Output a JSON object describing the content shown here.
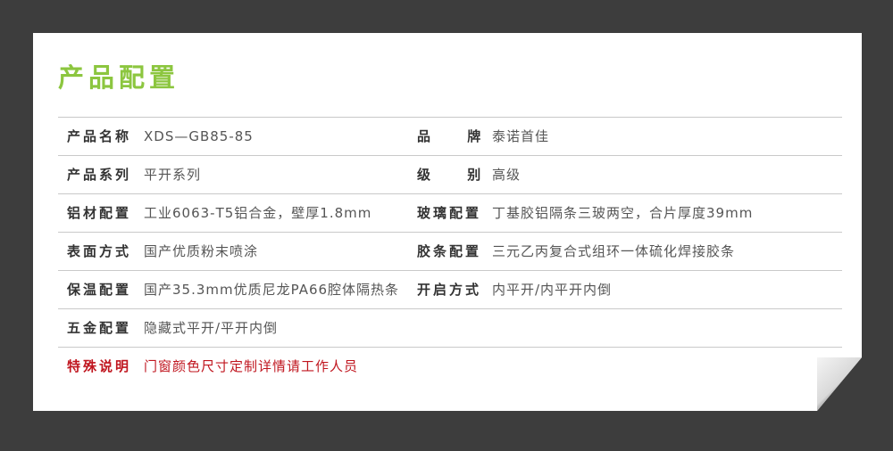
{
  "title": "产品配置",
  "colors": {
    "title": "#8cc63f",
    "special": "#c0161f",
    "label": "#333333",
    "value": "#555555",
    "background": "#3d3d3d"
  },
  "specs": [
    {
      "label1": "产品名称",
      "value1": "XDS—GB85-85",
      "label2": "品 牌",
      "value2": "泰诺首佳"
    },
    {
      "label1": "产品系列",
      "value1": "平开系列",
      "label2": "级 别",
      "value2": "高级"
    },
    {
      "label1": "铝材配置",
      "value1": "工业6063-T5铝合金，壁厚1.8mm",
      "label2": "玻璃配置",
      "value2": "丁基胶铝隔条三玻两空，合片厚度39mm"
    },
    {
      "label1": "表面方式",
      "value1": "国产优质粉末喷涂",
      "label2": "胶条配置",
      "value2": "三元乙丙复合式组环一体硫化焊接胶条"
    },
    {
      "label1": "保温配置",
      "value1": "国产35.3mm优质尼龙PA66腔体隔热条",
      "label2": "开启方式",
      "value2": "内平开/内平开内倒"
    },
    {
      "label1": "五金配置",
      "value1": "隐藏式平开/平开内倒"
    }
  ],
  "special": {
    "label": "特殊说明",
    "value": "门窗颜色尺寸定制详情请工作人员"
  }
}
